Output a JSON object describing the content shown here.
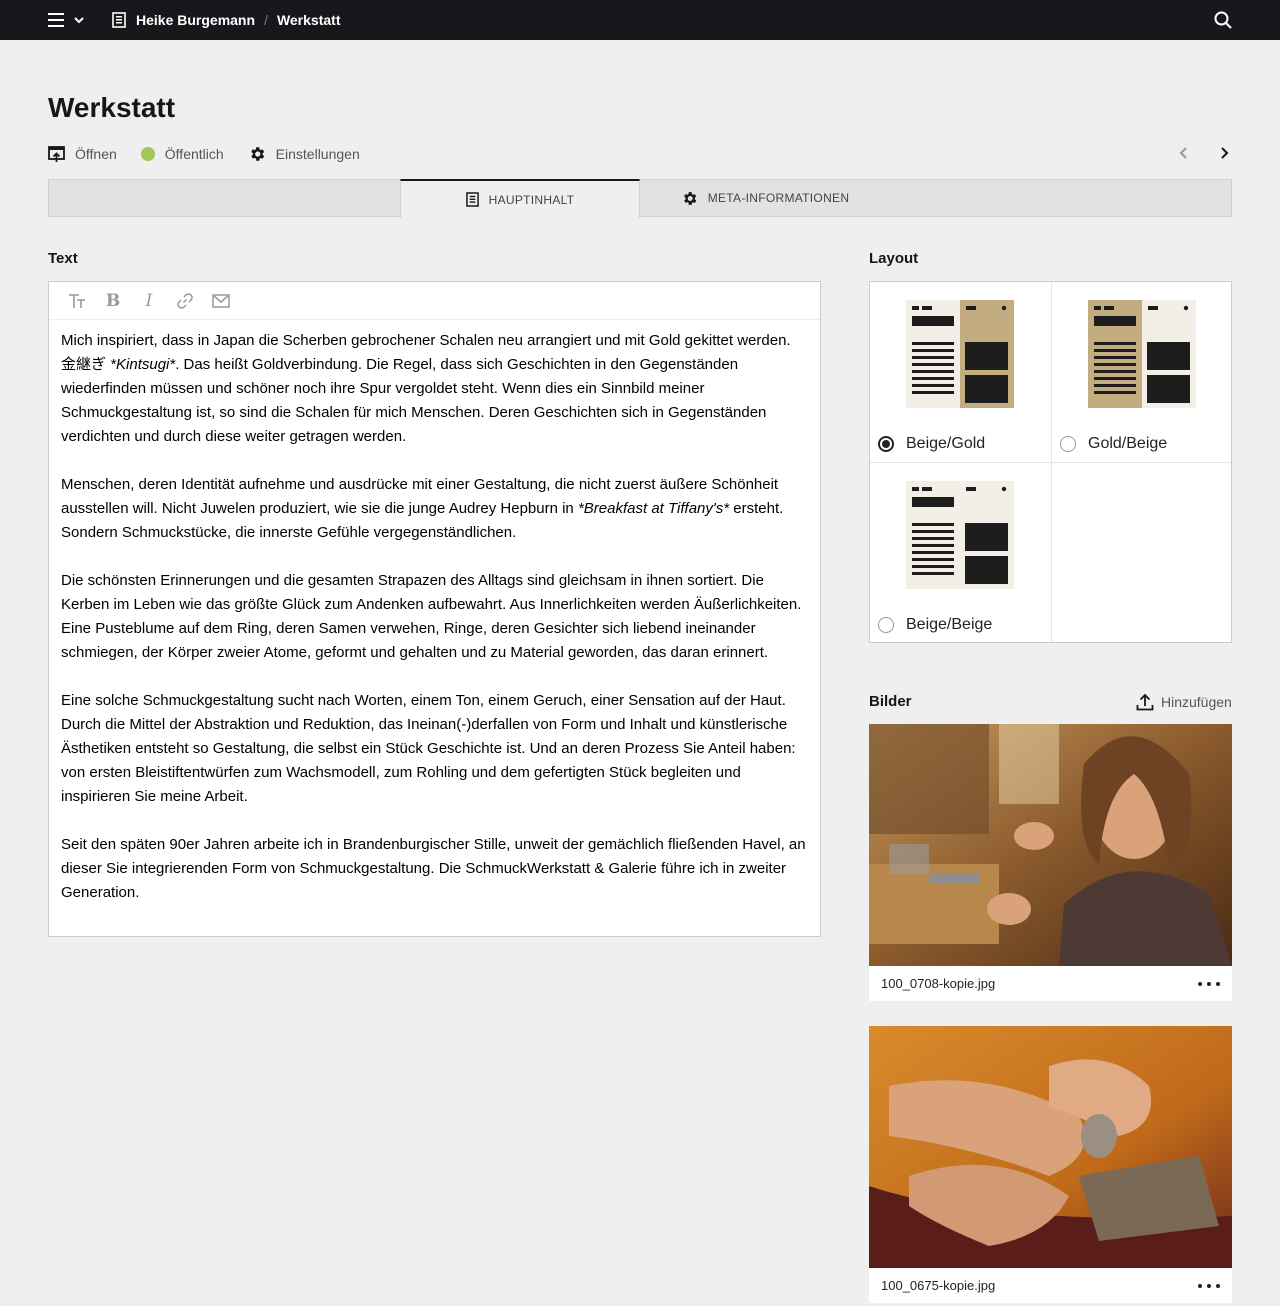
{
  "topbar": {
    "breadcrumb": [
      "Heike Burgemann",
      "Werkstatt"
    ],
    "separator": "/",
    "icons": [
      "hamburger-icon",
      "chevron-down-icon",
      "page-icon",
      "search-icon"
    ]
  },
  "page": {
    "title": "Werkstatt",
    "actions": {
      "open": "Öffnen",
      "status": "Öffentlich",
      "status_color": "#a4c65a",
      "settings": "Einstellungen"
    }
  },
  "tabs": [
    {
      "label": "",
      "active": false
    },
    {
      "label": "HAUPTINHALT",
      "active": true,
      "icon": "page-icon"
    },
    {
      "label": "META-INFORMATIONEN",
      "active": false,
      "icon": "gear-icon"
    }
  ],
  "text_section": {
    "label": "Text",
    "toolbar": [
      "heading-icon",
      "bold-icon",
      "italic-icon",
      "link-icon",
      "email-icon"
    ],
    "paragraphs": [
      [
        "Mich inspiriert, dass in Japan die Scherben gebrochener Schalen neu arrangiert und mit Gold gekittet werden. 金継ぎ ",
        "*Kintsugi*",
        ". Das heißt Goldverbindung. Die Regel, dass sich Geschichten in den Gegenständen wiederfinden müssen und schöner noch ihre Spur vergoldet steht. Wenn dies ein Sinnbild meiner Schmuckgestaltung ist, so sind die Schalen für mich Menschen. Deren Geschichten sich in Gegenständen verdichten und durch diese weiter getragen werden."
      ],
      [
        "Menschen, deren Identität aufnehme und ausdrücke mit einer Gestaltung, die nicht zuerst äußere Schönheit ausstellen will. Nicht Juwelen produziert, wie sie die junge Audrey Hepburn in ",
        "*Breakfast at Tiffany's*",
        " ersteht. Sondern Schmuckstücke, die innerste Gefühle vergegenständlichen."
      ],
      [
        "Die schönsten Erinnerungen und die gesamten Strapazen des Alltags sind gleichsam in ihnen sortiert. Die Kerben im Leben wie das größte Glück zum Andenken aufbewahrt. Aus Innerlichkeiten werden Äußerlichkeiten. Eine Pusteblume auf dem Ring, deren Samen verwehen, Ringe, deren Gesichter sich liebend ineinander schmiegen, der Körper zweier Atome, geformt und gehalten und zu Material geworden, das daran erinnert."
      ],
      [
        "Eine solche Schmuckgestaltung sucht nach Worten, einem Ton, einem Geruch, einer Sensation auf der Haut. Durch die Mittel der Abstraktion und Reduktion, das Ineinan(-)derfallen von Form und Inhalt und künstlerische Ästhetiken entsteht so Gestaltung, die selbst ein Stück Geschichte ist. Und an deren Prozess Sie Anteil haben: von ersten Bleistiftentwürfen zum Wachsmodell, zum Rohling und dem gefertigten Stück begleiten und inspirieren Sie meine Arbeit."
      ],
      [
        "Seit den späten 90er Jahren arbeite ich in Brandenburgischer Stille, unweit der gemächlich fließenden Havel, an dieser Sie integrierenden Form von Schmuckgestaltung. Die SchmuckWerkstatt & Galerie führe ich in zweiter Generation."
      ]
    ]
  },
  "layout_section": {
    "label": "Layout",
    "options": [
      {
        "label": "Beige/Gold",
        "selected": true,
        "left": "#f3efe7",
        "right": "#c3ad80"
      },
      {
        "label": "Gold/Beige",
        "selected": false,
        "left": "#c3ad80",
        "right": "#f3efe7"
      },
      {
        "label": "Beige/Beige",
        "selected": false,
        "left": "#f3efe7",
        "right": "#f3efe7"
      }
    ]
  },
  "images_section": {
    "label": "Bilder",
    "add_label": "Hinzufügen",
    "items": [
      {
        "filename": "100_0708-kopie.jpg"
      },
      {
        "filename": "100_0675-kopie.jpg"
      }
    ]
  }
}
